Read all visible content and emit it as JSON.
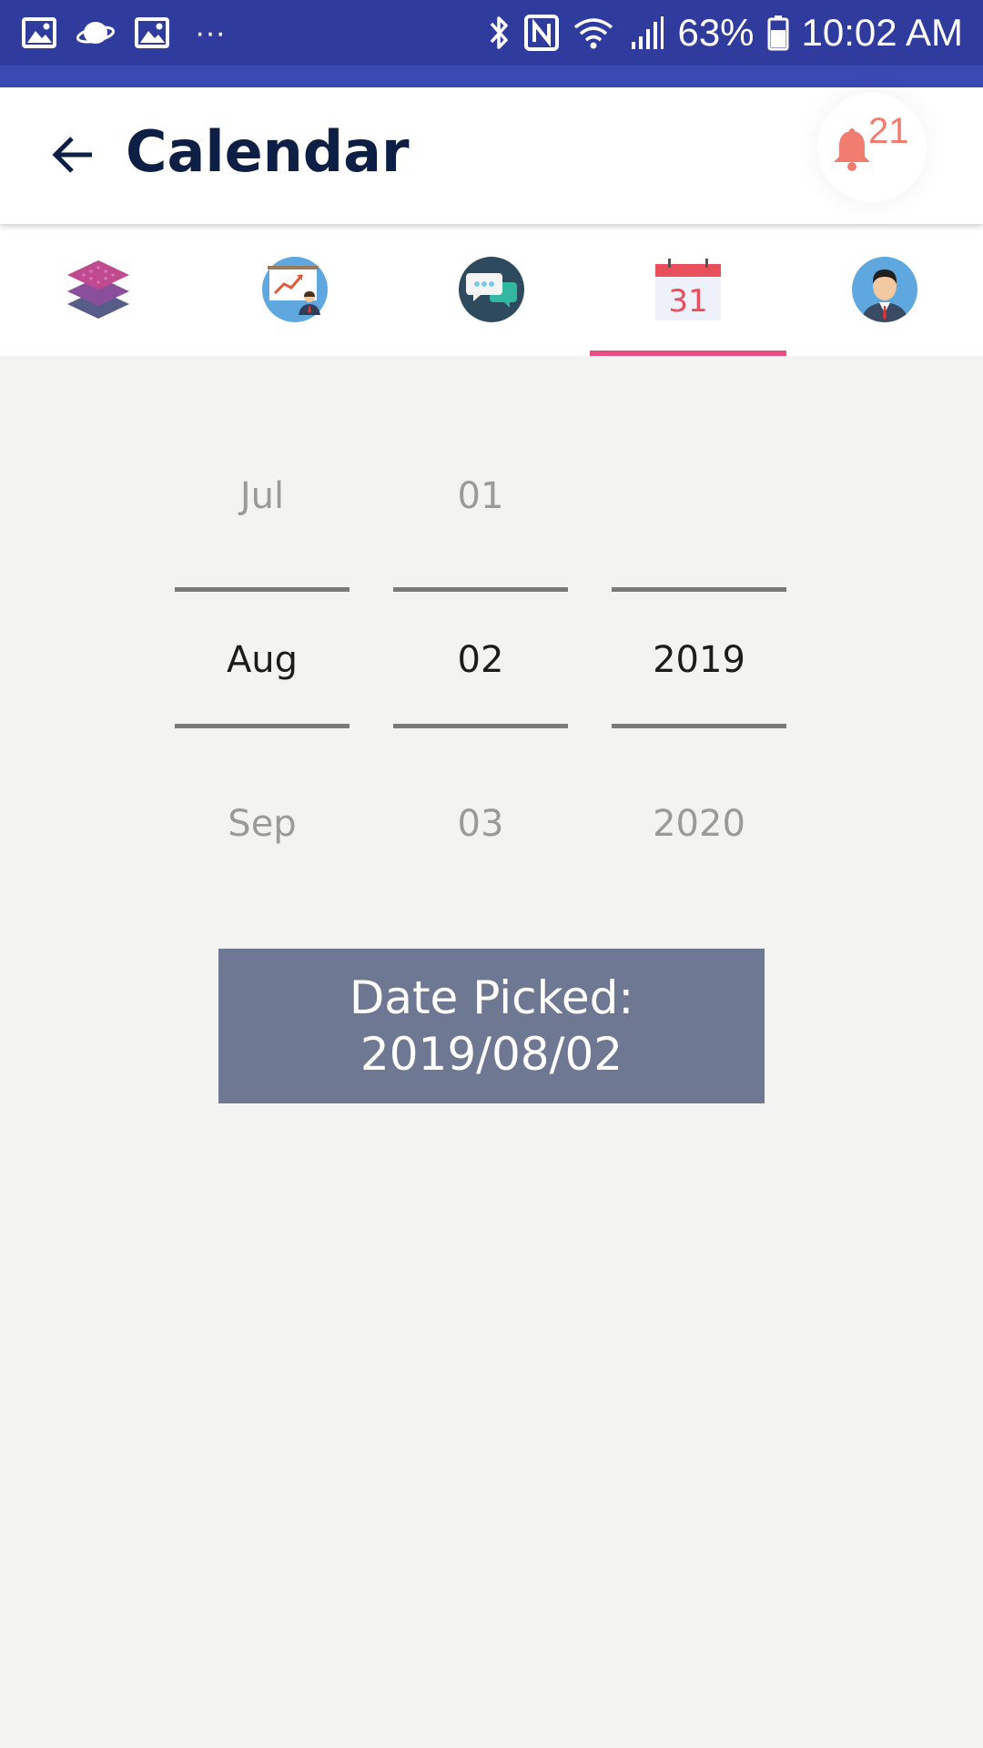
{
  "status_bar": {
    "more_indicator": "···",
    "battery_percent": "63%",
    "time": "10:02 AM",
    "icons": [
      "image-icon",
      "planet-icon",
      "image-icon",
      "bluetooth-icon",
      "nfc-icon",
      "wifi-icon",
      "signal-icon",
      "battery-icon"
    ]
  },
  "app_bar": {
    "title": "Calendar",
    "notification_count": "21",
    "colors": {
      "title": "#0e1f45",
      "bell": "#f07d6f"
    }
  },
  "tabs": [
    {
      "icon": "layers-icon",
      "selected": false
    },
    {
      "icon": "presentation-icon",
      "selected": false
    },
    {
      "icon": "chat-icon",
      "selected": false
    },
    {
      "icon": "calendar-icon",
      "label": "31",
      "selected": true
    },
    {
      "icon": "profile-icon",
      "selected": false
    }
  ],
  "date_picker": {
    "month": {
      "prev": "Jul",
      "current": "Aug",
      "next": "Sep"
    },
    "day": {
      "prev": "01",
      "current": "02",
      "next": "03"
    },
    "year": {
      "prev": "",
      "current": "2019",
      "next": "2020"
    }
  },
  "result": {
    "label": "Date Picked:",
    "value": "2019/08/02"
  },
  "colors": {
    "status_bar": "#2f3c9e",
    "tab_indicator": "#e94f7e",
    "result_box": "#6e7892",
    "background": "#f3f3f2"
  }
}
